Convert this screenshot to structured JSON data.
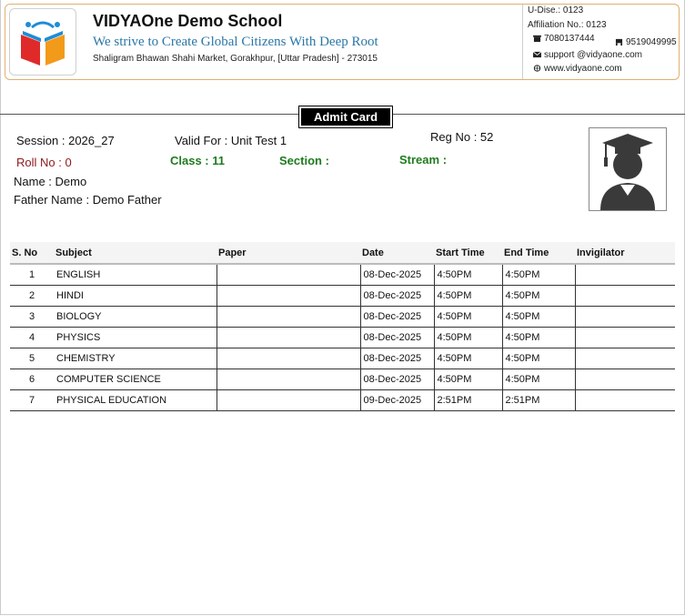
{
  "school": {
    "name": "VIDYAOne Demo School",
    "tagline": "We strive to Create Global Citizens With Deep Root",
    "address": "Shaligram Bhawan Shahi Market, Gorakhpur, [Uttar Pradesh] - 273015",
    "udise": "U-Dise.: 0123",
    "affiliation": "Affiliation No.: 0123",
    "phone1": "7080137444",
    "phone2": "9519049995",
    "email": "support @vidyaone.com",
    "website": "www.vidyaone.com"
  },
  "card": {
    "title": "Admit Card",
    "session": "Session : 2026_27",
    "valid_for": "Valid For : Unit Test 1",
    "reg_no": "Reg No : 52",
    "roll_no": "Roll No : 0",
    "class": "Class : 11",
    "section": "Section :",
    "stream": "Stream :",
    "name": "Name : Demo",
    "father_name": "Father Name : Demo Father"
  },
  "colors": {
    "tagline": "#2a76a8",
    "roll": "#8b1a1a",
    "label_green": "#1e7b1e",
    "header_border": "#e0b070"
  },
  "icons": [
    "book-logo-icon",
    "landline-icon",
    "phone-icon",
    "email-icon",
    "web-icon",
    "student-silhouette-icon"
  ],
  "table": {
    "headers": [
      "S. No",
      "Subject",
      "Paper",
      "Date",
      "Start Time",
      "End Time",
      "Invigilator"
    ],
    "rows": [
      {
        "sn": "1",
        "subject": "ENGLISH",
        "paper": "",
        "date": "08-Dec-2025",
        "start": "4:50PM",
        "end": "4:50PM",
        "invigilator": ""
      },
      {
        "sn": "2",
        "subject": "HINDI",
        "paper": "",
        "date": "08-Dec-2025",
        "start": "4:50PM",
        "end": "4:50PM",
        "invigilator": ""
      },
      {
        "sn": "3",
        "subject": "BIOLOGY",
        "paper": "",
        "date": "08-Dec-2025",
        "start": "4:50PM",
        "end": "4:50PM",
        "invigilator": ""
      },
      {
        "sn": "4",
        "subject": "PHYSICS",
        "paper": "",
        "date": "08-Dec-2025",
        "start": "4:50PM",
        "end": "4:50PM",
        "invigilator": ""
      },
      {
        "sn": "5",
        "subject": "CHEMISTRY",
        "paper": "",
        "date": "08-Dec-2025",
        "start": "4:50PM",
        "end": "4:50PM",
        "invigilator": ""
      },
      {
        "sn": "6",
        "subject": "COMPUTER SCIENCE",
        "paper": "",
        "date": "08-Dec-2025",
        "start": "4:50PM",
        "end": "4:50PM",
        "invigilator": ""
      },
      {
        "sn": "7",
        "subject": "PHYSICAL EDUCATION",
        "paper": "",
        "date": "09-Dec-2025",
        "start": "2:51PM",
        "end": "2:51PM",
        "invigilator": ""
      }
    ]
  }
}
